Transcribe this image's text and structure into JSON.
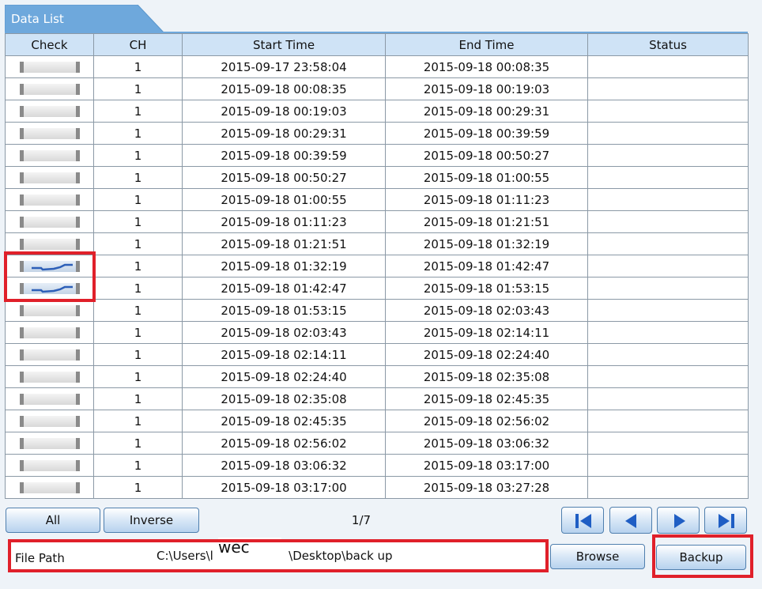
{
  "tab": {
    "title": "Data List"
  },
  "table": {
    "headers": [
      "Check",
      "CH",
      "Start Time",
      "End Time",
      "Status"
    ],
    "rows": [
      {
        "checked": false,
        "ch": "1",
        "start": "2015-09-17 23:58:04",
        "end": "2015-09-18 00:08:35",
        "status": ""
      },
      {
        "checked": false,
        "ch": "1",
        "start": "2015-09-18 00:08:35",
        "end": "2015-09-18 00:19:03",
        "status": ""
      },
      {
        "checked": false,
        "ch": "1",
        "start": "2015-09-18 00:19:03",
        "end": "2015-09-18 00:29:31",
        "status": ""
      },
      {
        "checked": false,
        "ch": "1",
        "start": "2015-09-18 00:29:31",
        "end": "2015-09-18 00:39:59",
        "status": ""
      },
      {
        "checked": false,
        "ch": "1",
        "start": "2015-09-18 00:39:59",
        "end": "2015-09-18 00:50:27",
        "status": ""
      },
      {
        "checked": false,
        "ch": "1",
        "start": "2015-09-18 00:50:27",
        "end": "2015-09-18 01:00:55",
        "status": ""
      },
      {
        "checked": false,
        "ch": "1",
        "start": "2015-09-18 01:00:55",
        "end": "2015-09-18 01:11:23",
        "status": ""
      },
      {
        "checked": false,
        "ch": "1",
        "start": "2015-09-18 01:11:23",
        "end": "2015-09-18 01:21:51",
        "status": ""
      },
      {
        "checked": false,
        "ch": "1",
        "start": "2015-09-18 01:21:51",
        "end": "2015-09-18 01:32:19",
        "status": ""
      },
      {
        "checked": true,
        "ch": "1",
        "start": "2015-09-18 01:32:19",
        "end": "2015-09-18 01:42:47",
        "status": ""
      },
      {
        "checked": true,
        "ch": "1",
        "start": "2015-09-18 01:42:47",
        "end": "2015-09-18 01:53:15",
        "status": ""
      },
      {
        "checked": false,
        "ch": "1",
        "start": "2015-09-18 01:53:15",
        "end": "2015-09-18 02:03:43",
        "status": ""
      },
      {
        "checked": false,
        "ch": "1",
        "start": "2015-09-18 02:03:43",
        "end": "2015-09-18 02:14:11",
        "status": ""
      },
      {
        "checked": false,
        "ch": "1",
        "start": "2015-09-18 02:14:11",
        "end": "2015-09-18 02:24:40",
        "status": ""
      },
      {
        "checked": false,
        "ch": "1",
        "start": "2015-09-18 02:24:40",
        "end": "2015-09-18 02:35:08",
        "status": ""
      },
      {
        "checked": false,
        "ch": "1",
        "start": "2015-09-18 02:35:08",
        "end": "2015-09-18 02:45:35",
        "status": ""
      },
      {
        "checked": false,
        "ch": "1",
        "start": "2015-09-18 02:45:35",
        "end": "2015-09-18 02:56:02",
        "status": ""
      },
      {
        "checked": false,
        "ch": "1",
        "start": "2015-09-18 02:56:02",
        "end": "2015-09-18 03:06:32",
        "status": ""
      },
      {
        "checked": false,
        "ch": "1",
        "start": "2015-09-18 03:06:32",
        "end": "2015-09-18 03:17:00",
        "status": ""
      },
      {
        "checked": false,
        "ch": "1",
        "start": "2015-09-18 03:17:00",
        "end": "2015-09-18 03:27:28",
        "status": ""
      }
    ]
  },
  "controls": {
    "all_label": "All",
    "inverse_label": "Inverse",
    "page_indicator": "1/7",
    "nav_icons": [
      "first-page-icon",
      "previous-page-icon",
      "next-page-icon",
      "last-page-icon"
    ]
  },
  "filepath": {
    "label": "File Path",
    "value": "C:\\Users\\l                    \\Desktop\\back up",
    "overlay_text": "wec",
    "browse_label": "Browse",
    "backup_label": "Backup"
  },
  "colors": {
    "tab": "#6ea8dc",
    "header": "#cfe3f6",
    "highlight": "#e0202a"
  }
}
